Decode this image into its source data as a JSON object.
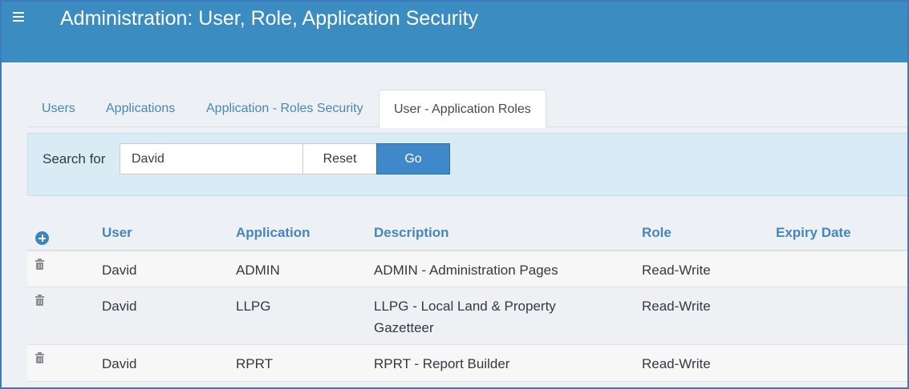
{
  "header": {
    "title": "Administration: User, Role, Application Security",
    "menu_icon": "hamburger-menu-icon",
    "background_color": "#3b8cc0"
  },
  "tabs": [
    {
      "label": "Users",
      "active": false
    },
    {
      "label": "Applications",
      "active": false
    },
    {
      "label": "Application - Roles Security",
      "active": false
    },
    {
      "label": "User - Application Roles",
      "active": true
    }
  ],
  "search": {
    "label": "Search for",
    "value": "David",
    "reset_label": "Reset",
    "go_label": "Go"
  },
  "table": {
    "add_icon": "plus-circle-icon",
    "delete_icon": "trash-icon",
    "columns": [
      "User",
      "Application",
      "Description",
      "Role",
      "Expiry Date"
    ],
    "rows": [
      {
        "user": "David",
        "application": "ADMIN",
        "description": "ADMIN - Administration Pages",
        "role": "Read-Write",
        "expiry": ""
      },
      {
        "user": "David",
        "application": "LLPG",
        "description": "LLPG - Local Land & Property Gazetteer",
        "role": "Read-Write",
        "expiry": ""
      },
      {
        "user": "David",
        "application": "RPRT",
        "description": "RPRT - Report Builder",
        "role": "Read-Write",
        "expiry": ""
      }
    ]
  }
}
